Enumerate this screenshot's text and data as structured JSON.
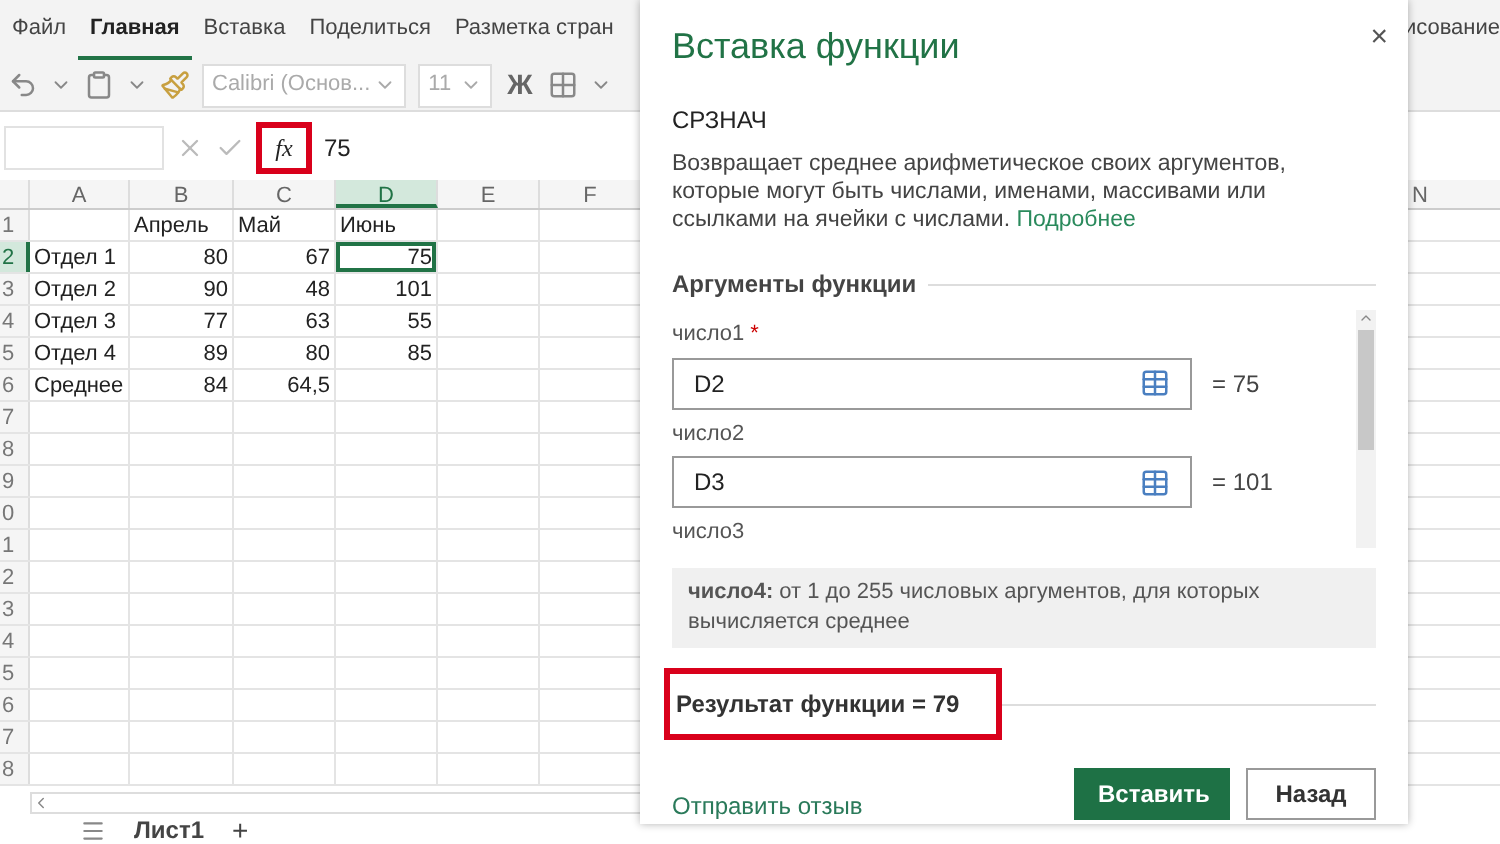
{
  "ribbon": {
    "tabs": [
      {
        "label": "Файл",
        "selected": false
      },
      {
        "label": "Главная",
        "selected": true
      },
      {
        "label": "Вставка",
        "selected": false
      },
      {
        "label": "Поделиться",
        "selected": false
      },
      {
        "label": "Разметка стран",
        "selected": false
      }
    ],
    "right_tab": "исование",
    "font": "Calibri (Основ...",
    "size": "11",
    "bold": "Ж"
  },
  "formula_bar": {
    "fx": "fx",
    "fx_highlighted": true,
    "value": "75"
  },
  "sheet": {
    "columns": [
      {
        "letter": "A",
        "selected": false
      },
      {
        "letter": "B",
        "selected": false
      },
      {
        "letter": "C",
        "selected": false
      },
      {
        "letter": "D",
        "selected": true
      },
      {
        "letter": "E",
        "selected": false
      },
      {
        "letter": "F",
        "selected": false
      }
    ],
    "right_column": "N",
    "rows": [
      {
        "number": "1",
        "selected": false,
        "cells": {
          "B": {
            "text": "Апрель",
            "kind": "label",
            "selected": false
          },
          "C": {
            "text": "Май",
            "kind": "label",
            "selected": false
          },
          "D": {
            "text": "Июнь",
            "kind": "label",
            "selected": false
          }
        }
      },
      {
        "number": "2",
        "selected": true,
        "cells": {
          "A": {
            "text": "Отдел 1",
            "selected": false
          },
          "B": {
            "text": "80",
            "kind": "number",
            "selected": false
          },
          "C": {
            "text": "67",
            "kind": "number",
            "selected": false
          },
          "D": {
            "text": "75",
            "kind": "number",
            "selected": true
          }
        }
      },
      {
        "number": "3",
        "selected": false,
        "cells": {
          "A": {
            "text": "Отдел 2",
            "selected": false
          },
          "B": {
            "text": "90",
            "kind": "number",
            "selected": false
          },
          "C": {
            "text": "48",
            "kind": "number",
            "selected": false
          },
          "D": {
            "text": "101",
            "kind": "number",
            "selected": false
          }
        }
      },
      {
        "number": "4",
        "selected": false,
        "cells": {
          "A": {
            "text": "Отдел 3",
            "selected": false
          },
          "B": {
            "text": "77",
            "kind": "number",
            "selected": false
          },
          "C": {
            "text": "63",
            "kind": "number",
            "selected": false
          },
          "D": {
            "text": "55",
            "kind": "number",
            "selected": false
          }
        }
      },
      {
        "number": "5",
        "selected": false,
        "cells": {
          "A": {
            "text": "Отдел 4",
            "selected": false
          },
          "B": {
            "text": "89",
            "kind": "number",
            "selected": false
          },
          "C": {
            "text": "80",
            "kind": "number",
            "selected": false
          },
          "D": {
            "text": "85",
            "kind": "number",
            "selected": false
          }
        }
      },
      {
        "number": "6",
        "selected": false,
        "cells": {
          "A": {
            "text": "Среднее",
            "selected": false
          },
          "B": {
            "text": "84",
            "kind": "number",
            "selected": false
          },
          "C": {
            "text": "64,5",
            "kind": "number",
            "selected": false
          }
        }
      },
      {
        "number": "7",
        "selected": false
      },
      {
        "number": "8",
        "selected": false
      },
      {
        "number": "9",
        "selected": false
      },
      {
        "number": "0",
        "selected": false
      },
      {
        "number": "1",
        "selected": false
      },
      {
        "number": "2",
        "selected": false
      },
      {
        "number": "3",
        "selected": false
      },
      {
        "number": "4",
        "selected": false
      },
      {
        "number": "5",
        "selected": false
      },
      {
        "number": "6",
        "selected": false
      },
      {
        "number": "7",
        "selected": false
      },
      {
        "number": "8",
        "selected": false
      }
    ],
    "sheet_tab": "Лист1",
    "add_sheet": "+"
  },
  "dialog": {
    "title": "Вставка функции",
    "close": "×",
    "function_name": "СРЗНАЧ",
    "description": "Возвращает среднее арифметическое своих аргументов, которые могут быть числами, именами, массивами или ссылками на ячейки с числами.",
    "more_link": "Подробнее",
    "arguments_heading": "Аргументы функции",
    "arguments": [
      {
        "label": "число1",
        "required_mark": "*",
        "value": "D2",
        "result": "= 75"
      },
      {
        "label": "число2",
        "value": "D3",
        "result": "= 101"
      },
      {
        "label": "число3"
      }
    ],
    "hint": "**число4:** от 1 до 255 числовых аргументов, для которых вычисляется среднее",
    "result": "Результат функции = 79",
    "result_highlighted": true,
    "feedback_link": "Отправить отзыв",
    "buttons": [
      {
        "label": "Вставить",
        "kind": "primary"
      },
      {
        "label": "Назад",
        "kind": "secondary"
      }
    ]
  }
}
